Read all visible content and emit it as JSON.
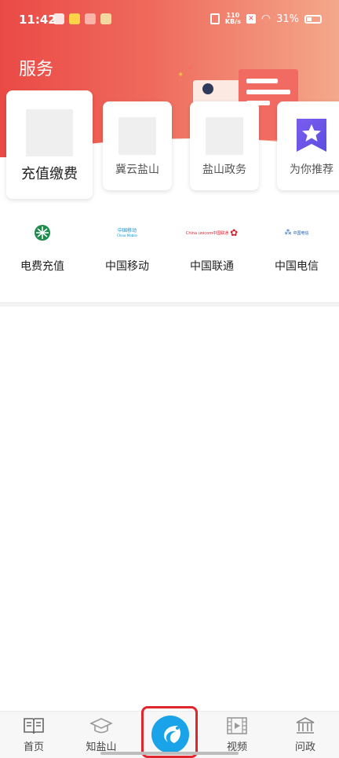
{
  "status_bar": {
    "time": "11:42",
    "net_speed_value": "110",
    "net_speed_unit": "KB/s",
    "battery": "31%"
  },
  "header": {
    "title": "服务"
  },
  "service_cards": [
    {
      "label": "充值缴费"
    },
    {
      "label": "冀云盐山"
    },
    {
      "label": "盐山政务"
    },
    {
      "label": "为你推荐"
    }
  ],
  "carriers": [
    {
      "name": "电费充值",
      "logo": "state-grid-logo"
    },
    {
      "name": "中国移动",
      "logo": "china-mobile-logo",
      "logo_text_cn": "中国移动",
      "logo_text_en": "China Mobile"
    },
    {
      "name": "中国联通",
      "logo": "china-unicom-logo",
      "logo_text_cn": "China unicom中国联通"
    },
    {
      "name": "中国电信",
      "logo": "china-telecom-logo",
      "logo_text_cn": "中国电信"
    }
  ],
  "bottom_nav": {
    "items": [
      {
        "label": "首页",
        "icon": "book-icon"
      },
      {
        "label": "知盐山",
        "icon": "graduation-cap-icon"
      },
      {
        "label": "",
        "icon": "app-logo-icon"
      },
      {
        "label": "视频",
        "icon": "film-icon"
      },
      {
        "label": "问政",
        "icon": "government-building-icon"
      }
    ]
  },
  "colors": {
    "header_start": "#ea4a45",
    "header_end": "#f4a88b",
    "center_highlight": "#e0262d",
    "app_blue": "#1aa3e8"
  }
}
